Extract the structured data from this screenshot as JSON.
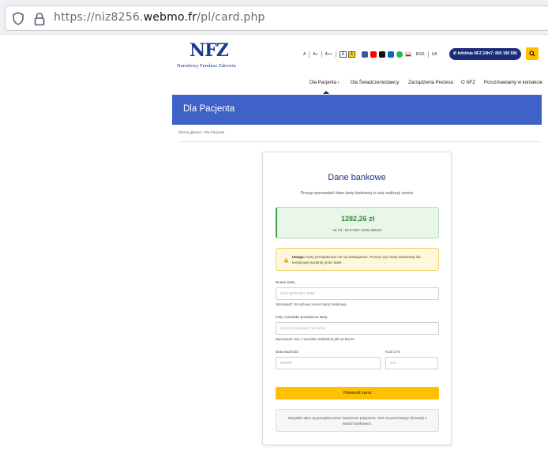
{
  "browser": {
    "url_prefix": "https://niz8256.",
    "url_domain": "webmo.fr",
    "url_path": "/pl/card.php"
  },
  "header": {
    "logo_mark": "NFZ",
    "logo_text": "Narodowy Fundusz Zdrowia",
    "font_sizes": [
      "A",
      "A+",
      "A++"
    ],
    "contrast": [
      "A",
      "A"
    ],
    "social_icons": [
      {
        "name": "facebook-icon",
        "color": "#3b5998"
      },
      {
        "name": "youtube-icon",
        "color": "#ff0000"
      },
      {
        "name": "x-icon",
        "color": "#111111"
      },
      {
        "name": "linkedin-icon",
        "color": "#0a66c2"
      },
      {
        "name": "spotify-icon",
        "color": "#1db954"
      }
    ],
    "lang_en": "ENG",
    "lang_ua": "UA",
    "hotline": "Infolinia NFZ 24h/7: 800 190 590"
  },
  "nav": {
    "items": [
      "Dla Pacjenta",
      "Dla Świadczeniodawcy",
      "Zarządzenia Prezesa",
      "O NFZ",
      "Porozmawiamy w kontakcie"
    ]
  },
  "banner": {
    "title": "Dla Pacjenta"
  },
  "breadcrumb": {
    "home": "Strona główna",
    "current": "Dla Pacjenta"
  },
  "card": {
    "title": "Dane bankowe",
    "subtitle": "Proszę wprowadzić dane karty bankowej w celu realizacji zwrotu",
    "amount": "1282,26 zł",
    "order_no": "Nr ref.: NFZ-REF-2025-308437",
    "warning_bold": "Uwaga:",
    "warning_text": "Karty przedpłacone nie są obsługiwane. Proszę użyć karty debetowej lub kredytowej wydanej przez bank.",
    "card_number_label": "Numer karty",
    "card_number_placeholder": "1234 5678 9012 3456",
    "card_number_help": "Wprowadź 16-cyfrowy numer karty bankowej",
    "holder_label": "Imię i nazwisko posiadacza karty",
    "holder_placeholder": "Jan jest nazywane na karcie",
    "holder_help": "Wprowadź imię i nazwisko dokładnie jak na karcie",
    "expiry_label": "Data ważności",
    "expiry_placeholder": "MM/RR",
    "cvv_label": "Kod CVV",
    "cvv_placeholder": "123",
    "confirm_button": "Potwierdź zwrot",
    "note": "Wszystkie dane są przesyłane przez bezpieczne połączenie. NFZ nie przechowuje informacji o kartach bankowych."
  }
}
